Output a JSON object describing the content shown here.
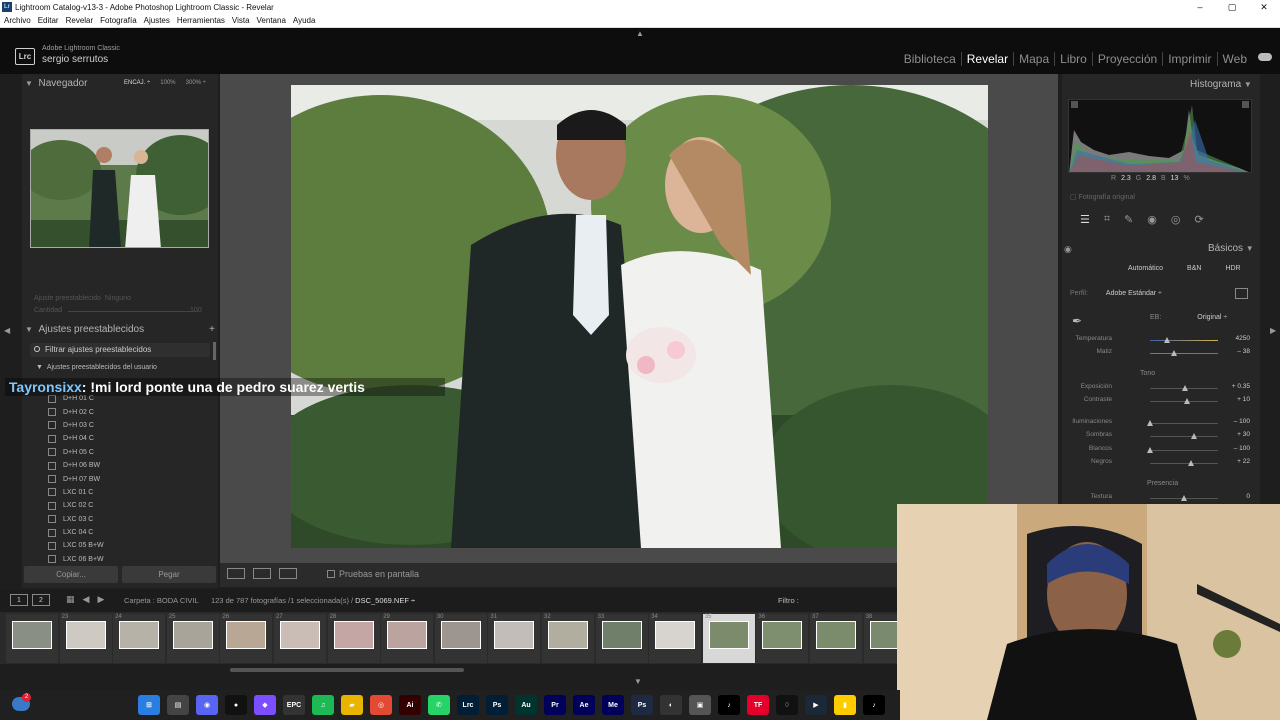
{
  "window": {
    "title": "Lightroom Catalog-v13-3 - Adobe Photoshop Lightroom Classic - Revelar",
    "app_badge": "Lr",
    "controls": [
      "–",
      "▢",
      "✕"
    ]
  },
  "menu": [
    "Archivo",
    "Editar",
    "Revelar",
    "Fotografía",
    "Ajustes",
    "Herramientas",
    "Vista",
    "Ventana",
    "Ayuda"
  ],
  "identity": {
    "logo": "Lrc",
    "product": "Adobe Lightroom Classic",
    "user": "sergio serrutos"
  },
  "modules": [
    "Biblioteca",
    "Revelar",
    "Mapa",
    "Libro",
    "Proyección",
    "Imprimir",
    "Web"
  ],
  "active_module": "Revelar",
  "navigator": {
    "title": "Navegador",
    "zoom": [
      "ENCAJ. ÷",
      "100%",
      "300% ÷"
    ]
  },
  "preset_amount": {
    "label": "Ajuste preestablecido",
    "value": "Ninguno",
    "amount_label": "Cantidad",
    "amount_value": "100"
  },
  "presets": {
    "title": "Ajustes preestablecidos",
    "filter": "Filtrar ajustes preestablecidos",
    "group": "Ajustes preestablecidos del usuario",
    "items": [
      "D+H 01 C",
      "D+H 02 C",
      "D+H 03 C",
      "D+H 04 C",
      "D+H 05 C",
      "D+H 06 BW",
      "D+H 07 BW",
      "LXC 01 C",
      "LXC 02 C",
      "LXC 03 C",
      "LXC 04 C",
      "LXC 05 B+W",
      "LXC 06 B+W"
    ]
  },
  "copy_paste": {
    "copy": "Copiar...",
    "paste": "Pegar"
  },
  "toolbar": {
    "proof": "Pruebas en pantalla"
  },
  "histogram": {
    "title": "Histograma",
    "r_label": "R",
    "r": "2.3",
    "g_label": "G",
    "g": "2.8",
    "b_label": "B",
    "b": "13",
    "unit": "%",
    "original": "Fotografía original"
  },
  "basics": {
    "title": "Básicos",
    "treatment": [
      "Automático",
      "B&N",
      "HDR"
    ],
    "profile_label": "Perfil:",
    "profile_value": "Adobe Estándar ÷",
    "wb_label": "EB:",
    "wb_value": "Original ÷",
    "tone_label": "Tono",
    "presence_label": "Presencia",
    "sliders": [
      {
        "label": "Temperatura",
        "value": "4250",
        "pos": 0.25
      },
      {
        "label": "Matiz",
        "value": "– 38",
        "pos": 0.36
      },
      {
        "label": "Exposición",
        "value": "+ 0.35",
        "pos": 0.52
      },
      {
        "label": "Contraste",
        "value": "+ 10",
        "pos": 0.55
      },
      {
        "label": "Iluminaciones",
        "value": "– 100",
        "pos": 0.0
      },
      {
        "label": "Sombras",
        "value": "+ 30",
        "pos": 0.65
      },
      {
        "label": "Blancos",
        "value": "– 100",
        "pos": 0.0
      },
      {
        "label": "Negros",
        "value": "+ 22",
        "pos": 0.61
      },
      {
        "label": "Textura",
        "value": "0",
        "pos": 0.5
      }
    ]
  },
  "filmstrip": {
    "pages": [
      "1",
      "2"
    ],
    "folder": "Carpeta : BODA CIVIL",
    "count": "123 de 787 fotografías /1 seleccionada(s) /",
    "file": "DSC_5069.NEF ÷",
    "filter": "Filtro :",
    "frames": [
      "",
      "23",
      "24",
      "25",
      "26",
      "27",
      "28",
      "29",
      "30",
      "31",
      "32",
      "33",
      "34",
      "35",
      "36",
      "37",
      "38"
    ],
    "selected": "35"
  },
  "chat": {
    "user": "Tayronsixx",
    "message": ": !mi lord ponte una de pedro suarez vertis"
  },
  "taskbar_apps": [
    {
      "label": "⊞",
      "color": "#2a7de1"
    },
    {
      "label": "▤",
      "color": "#444"
    },
    {
      "label": "◉",
      "color": "#5865f2"
    },
    {
      "label": "●",
      "color": "#111"
    },
    {
      "label": "◆",
      "color": "#7b4fff"
    },
    {
      "label": "EPC",
      "color": "#333"
    },
    {
      "label": "♫",
      "color": "#1db954"
    },
    {
      "label": "▰",
      "color": "#e8b400"
    },
    {
      "label": "◎",
      "color": "#e24a33"
    },
    {
      "label": "Ai",
      "color": "#330000"
    },
    {
      "label": "✆",
      "color": "#25d366"
    },
    {
      "label": "Lrc",
      "color": "#001e36"
    },
    {
      "label": "Ps",
      "color": "#001e36"
    },
    {
      "label": "Au",
      "color": "#00342f"
    },
    {
      "label": "Pr",
      "color": "#00005b"
    },
    {
      "label": "Ae",
      "color": "#00005b"
    },
    {
      "label": "Me",
      "color": "#00005b"
    },
    {
      "label": "Ps",
      "color": "#1e2a44"
    },
    {
      "label": "◐",
      "color": "#333"
    },
    {
      "label": "▣",
      "color": "#555"
    },
    {
      "label": "♪",
      "color": "#000"
    },
    {
      "label": "TF",
      "color": "#e4002b"
    },
    {
      "label": "♢",
      "color": "#111"
    },
    {
      "label": "▶",
      "color": "#1b2838"
    },
    {
      "label": "▮",
      "color": "#ffcc00"
    },
    {
      "label": "♪",
      "color": "#000"
    }
  ],
  "notification_count": "2"
}
